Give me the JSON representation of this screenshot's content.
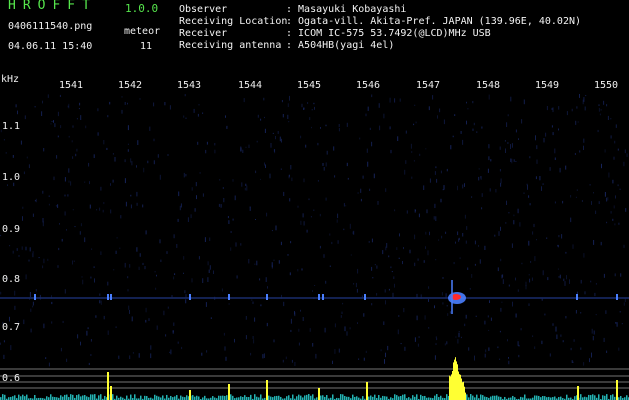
{
  "app": {
    "name": "HROFFT",
    "version": "1.0.0"
  },
  "file": {
    "name": "0406111540.png",
    "datetime": "04.06.11 15:40"
  },
  "mode": {
    "label": "meteor",
    "count": "11"
  },
  "info": [
    {
      "key": "Observer",
      "value": ": Masayuki Kobayashi"
    },
    {
      "key": "Receiving Location",
      "value": ": Ogata-vill. Akita-Pref. JAPAN (139.96E, 40.02N)"
    },
    {
      "key": "Receiver",
      "value": ": ICOM IC-575 53.7492(@LCD)MHz USB"
    },
    {
      "key": "Receiving antenna",
      "value": ": A504HB(yagi 4el)"
    }
  ],
  "plot": {
    "y_unit": "kHz",
    "y_ticks": [
      "1.1",
      "1.0",
      "0.9",
      "0.8",
      "0.7",
      "0.6"
    ],
    "x_ticks": [
      "1541",
      "1542",
      "1543",
      "1544",
      "1545",
      "1546",
      "1547",
      "1548",
      "1549",
      "1550"
    ],
    "colors": {
      "background": "#000000",
      "noise": "#1a2a6b",
      "trace": "#4a7fff",
      "echo": "#ff2a2a",
      "spectrum": "#ffff33",
      "spectrum_floor": "#33ffff",
      "reference_line": "#9a9a9a"
    }
  }
}
